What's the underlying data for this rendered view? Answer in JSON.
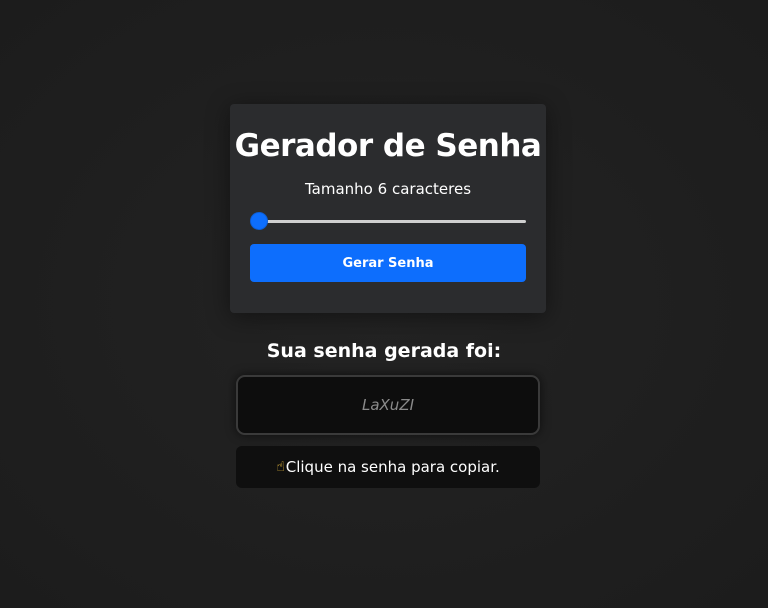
{
  "generator": {
    "title": "Gerador de Senha",
    "size_prefix": "Tamanho",
    "size_value": "6",
    "size_suffix": "caracteres",
    "slider": {
      "min": 6,
      "max": 30,
      "value": 6
    },
    "button_label": "Gerar Senha"
  },
  "result": {
    "title": "Sua senha gerada foi:",
    "password": "LaXuZI",
    "tooltip_icon": "pointing-hand-icon",
    "tooltip_glyph": "☝",
    "tooltip_text": "Clique na senha para copiar."
  },
  "colors": {
    "accent": "#0d6efd",
    "background": "#1e1e1e",
    "card": "#2b2c2e"
  }
}
